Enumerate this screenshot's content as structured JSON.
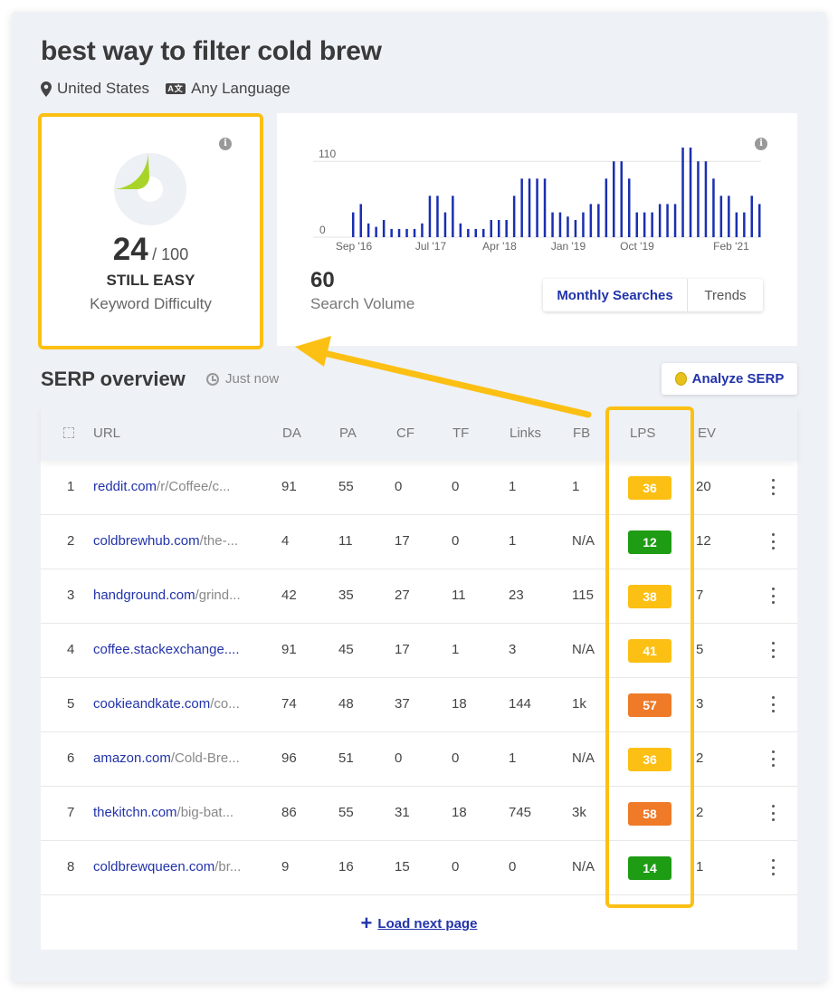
{
  "header": {
    "title": "best way to filter cold brew",
    "location": "United States",
    "language": "Any Language",
    "language_icon_text": "A文"
  },
  "keyword_difficulty": {
    "score": "24",
    "max": "/ 100",
    "level": "STILL EASY",
    "label": "Keyword Difficulty",
    "fraction": 0.24,
    "color": "#a8d42a"
  },
  "search_volume": {
    "value": "60",
    "label": "Search Volume",
    "tab_active": "Monthly Searches",
    "tab_inactive": "Trends",
    "chart_data": {
      "type": "bar",
      "y_ticks": [
        "110",
        "0"
      ],
      "ylim": [
        0,
        130
      ],
      "x_tick_labels": [
        "Sep '16",
        "Jul '17",
        "Apr '18",
        "Jan '19",
        "Oct '19",
        "Feb '21"
      ],
      "values": [
        36,
        48,
        20,
        15,
        25,
        12,
        12,
        12,
        12,
        20,
        60,
        60,
        36,
        60,
        20,
        12,
        12,
        12,
        25,
        25,
        25,
        60,
        85,
        85,
        85,
        85,
        36,
        36,
        30,
        25,
        36,
        48,
        48,
        85,
        110,
        110,
        85,
        36,
        36,
        36,
        48,
        48,
        48,
        130,
        130,
        110,
        110,
        85,
        60,
        60,
        36,
        36,
        60,
        48
      ],
      "color": "#1a2fb0"
    }
  },
  "serp": {
    "title": "SERP overview",
    "timestamp": "Just now",
    "analyze_label": "Analyze SERP",
    "columns": [
      "URL",
      "DA",
      "PA",
      "CF",
      "TF",
      "Links",
      "FB",
      "LPS",
      "EV"
    ],
    "rows": [
      {
        "n": "1",
        "domain": "reddit.com",
        "path": "/r/Coffee/c...",
        "da": "91",
        "pa": "55",
        "cf": "0",
        "tf": "0",
        "links": "1",
        "fb": "1",
        "lps": "36",
        "lps_color": "#fcbf13",
        "ev": "20"
      },
      {
        "n": "2",
        "domain": "coldbrewhub.com",
        "path": "/the-...",
        "da": "4",
        "pa": "11",
        "cf": "17",
        "tf": "0",
        "links": "1",
        "fb": "N/A",
        "lps": "12",
        "lps_color": "#1e9c14",
        "ev": "12"
      },
      {
        "n": "3",
        "domain": "handground.com",
        "path": "/grind...",
        "da": "42",
        "pa": "35",
        "cf": "27",
        "tf": "11",
        "links": "23",
        "fb": "115",
        "lps": "38",
        "lps_color": "#fcbf13",
        "ev": "7"
      },
      {
        "n": "4",
        "domain": "coffee.stackexchange....",
        "path": "",
        "da": "91",
        "pa": "45",
        "cf": "17",
        "tf": "1",
        "links": "3",
        "fb": "N/A",
        "lps": "41",
        "lps_color": "#fcbf13",
        "ev": "5"
      },
      {
        "n": "5",
        "domain": "cookieandkate.com",
        "path": "/co...",
        "da": "74",
        "pa": "48",
        "cf": "37",
        "tf": "18",
        "links": "144",
        "fb": "1k",
        "lps": "57",
        "lps_color": "#ef7a28",
        "ev": "3"
      },
      {
        "n": "6",
        "domain": "amazon.com",
        "path": "/Cold-Bre...",
        "da": "96",
        "pa": "51",
        "cf": "0",
        "tf": "0",
        "links": "1",
        "fb": "N/A",
        "lps": "36",
        "lps_color": "#fcbf13",
        "ev": "2"
      },
      {
        "n": "7",
        "domain": "thekitchn.com",
        "path": "/big-bat...",
        "da": "86",
        "pa": "55",
        "cf": "31",
        "tf": "18",
        "links": "745",
        "fb": "3k",
        "lps": "58",
        "lps_color": "#ef7a28",
        "ev": "2"
      },
      {
        "n": "8",
        "domain": "coldbrewqueen.com",
        "path": "/br...",
        "da": "9",
        "pa": "16",
        "cf": "15",
        "tf": "0",
        "links": "0",
        "fb": "N/A",
        "lps": "14",
        "lps_color": "#1e9c14",
        "ev": "1"
      }
    ],
    "load_more": "Load next page"
  },
  "highlight_color": "#fcc014"
}
